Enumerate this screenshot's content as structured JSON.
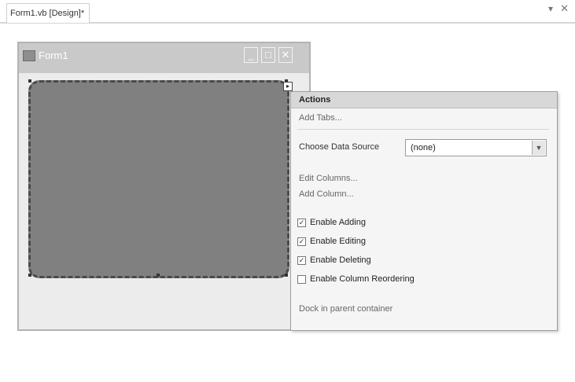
{
  "document_tab": {
    "label": "Form1.vb [Design]*",
    "menu_glyph": "▾",
    "close_glyph": "✕"
  },
  "form_window": {
    "title": "Form1",
    "minimize_glyph": "_",
    "maximize_glyph": "□",
    "close_glyph": "✕",
    "smart_tag_glyph": "▸"
  },
  "actions_panel": {
    "title": "Actions",
    "top_link": "Add Tabs...",
    "data_source_label": "Choose Data Source",
    "data_source_value": "(none)",
    "edit_columns_link": "Edit Columns...",
    "add_column_link": "Add Column...",
    "checkboxes": [
      {
        "label": "Enable Adding",
        "checked": true
      },
      {
        "label": "Enable Editing",
        "checked": true
      },
      {
        "label": "Enable Deleting",
        "checked": true
      },
      {
        "label": "Enable Column Reordering",
        "checked": false
      }
    ],
    "dock_link": "Dock in parent container"
  }
}
